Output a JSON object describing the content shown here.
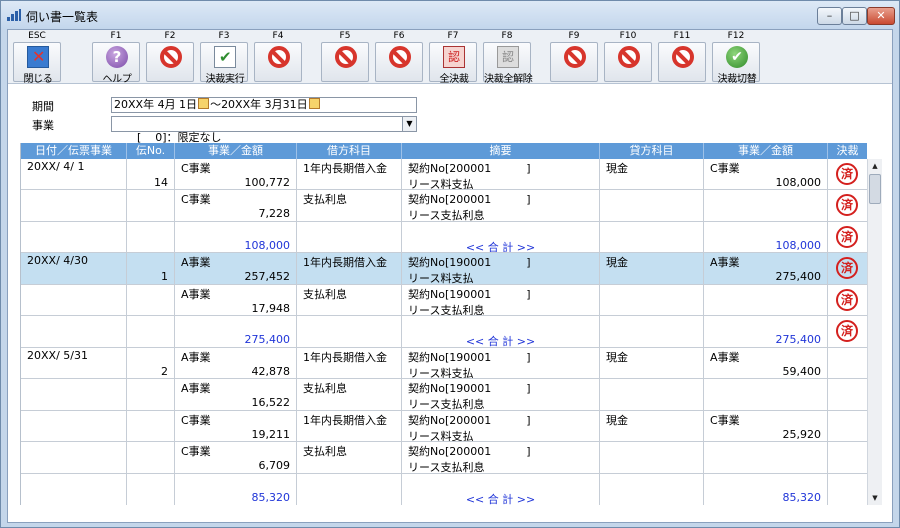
{
  "window": {
    "title": "伺い書一覧表",
    "minimize": "–",
    "maximize": "□",
    "close": "✕"
  },
  "toolbar": [
    {
      "key": "ESC",
      "label": "閉じる",
      "icon": "exit-icon",
      "name": "close-button"
    },
    {
      "key": "F1",
      "label": "ヘルプ",
      "icon": "help-icon",
      "name": "help-button"
    },
    {
      "key": "F2",
      "label": "",
      "icon": "disabled-icon",
      "name": "f2-button"
    },
    {
      "key": "F3",
      "label": "決裁実行",
      "icon": "check-icon",
      "name": "approve-button"
    },
    {
      "key": "F4",
      "label": "",
      "icon": "disabled-icon",
      "name": "f4-button"
    },
    {
      "key": "F5",
      "label": "",
      "icon": "disabled-icon",
      "name": "f5-button"
    },
    {
      "key": "F6",
      "label": "",
      "icon": "disabled-icon",
      "name": "f6-button"
    },
    {
      "key": "F7",
      "label": "全決裁",
      "icon": "stamp-icon",
      "name": "approve-all-button"
    },
    {
      "key": "F8",
      "label": "決裁全解除",
      "icon": "stamp-gray-icon",
      "name": "unapprove-all-button"
    },
    {
      "key": "F9",
      "label": "",
      "icon": "disabled-icon",
      "name": "f9-button"
    },
    {
      "key": "F10",
      "label": "",
      "icon": "disabled-icon",
      "name": "f10-button"
    },
    {
      "key": "F11",
      "label": "",
      "icon": "disabled-icon",
      "name": "f11-button"
    },
    {
      "key": "F12",
      "label": "決裁切替",
      "icon": "ok-icon",
      "name": "toggle-approval-button"
    }
  ],
  "filters": {
    "period_label": "期間",
    "period_start": "20XX年 4月 1日",
    "period_sep": "～",
    "period_end": "20XX年 3月31日",
    "business_label": "事業",
    "business_value": "[    0]：限定なし"
  },
  "columns": [
    "日付／伝票事業",
    "伝No.",
    "事業／金額",
    "借方科目",
    "摘要",
    "貸方科目",
    "事業／金額",
    "決裁"
  ],
  "rows": [
    {
      "date": "20XX/ 4/ 1",
      "no": "14",
      "dr_biz": "C事業",
      "dr_amt": "100,772",
      "dr_acct": "1年内長期借入金",
      "memo1": "契約No[200001          ]",
      "memo2": "リース料支払",
      "cr_acct": "現金",
      "cr_biz": "C事業",
      "cr_amt": "108,000",
      "stamp": "済",
      "selected": false,
      "total": false
    },
    {
      "date": "",
      "no": "",
      "dr_biz": "C事業",
      "dr_amt": "7,228",
      "dr_acct": "支払利息",
      "memo1": "契約No[200001          ]",
      "memo2": "リース支払利息",
      "cr_acct": "",
      "cr_biz": "",
      "cr_amt": "",
      "stamp": "済",
      "selected": false,
      "total": false
    },
    {
      "date": "",
      "no": "",
      "dr_biz": "",
      "dr_amt": "108,000",
      "dr_acct": "",
      "memo1": "",
      "memo2": "<< 合 計 >>",
      "cr_acct": "",
      "cr_biz": "",
      "cr_amt": "108,000",
      "stamp": "済",
      "selected": false,
      "total": true
    },
    {
      "date": "20XX/ 4/30",
      "no": "1",
      "dr_biz": "A事業",
      "dr_amt": "257,452",
      "dr_acct": "1年内長期借入金",
      "memo1": "契約No[190001          ]",
      "memo2": "リース料支払",
      "cr_acct": "現金",
      "cr_biz": "A事業",
      "cr_amt": "275,400",
      "stamp": "済",
      "selected": true,
      "total": false
    },
    {
      "date": "",
      "no": "",
      "dr_biz": "A事業",
      "dr_amt": "17,948",
      "dr_acct": "支払利息",
      "memo1": "契約No[190001          ]",
      "memo2": "リース支払利息",
      "cr_acct": "",
      "cr_biz": "",
      "cr_amt": "",
      "stamp": "済",
      "selected": false,
      "total": false
    },
    {
      "date": "",
      "no": "",
      "dr_biz": "",
      "dr_amt": "275,400",
      "dr_acct": "",
      "memo1": "",
      "memo2": "<< 合 計 >>",
      "cr_acct": "",
      "cr_biz": "",
      "cr_amt": "275,400",
      "stamp": "済",
      "selected": false,
      "total": true
    },
    {
      "date": "20XX/ 5/31",
      "no": "2",
      "dr_biz": "A事業",
      "dr_amt": "42,878",
      "dr_acct": "1年内長期借入金",
      "memo1": "契約No[190001          ]",
      "memo2": "リース料支払",
      "cr_acct": "現金",
      "cr_biz": "A事業",
      "cr_amt": "59,400",
      "stamp": "",
      "selected": false,
      "total": false
    },
    {
      "date": "",
      "no": "",
      "dr_biz": "A事業",
      "dr_amt": "16,522",
      "dr_acct": "支払利息",
      "memo1": "契約No[190001          ]",
      "memo2": "リース支払利息",
      "cr_acct": "",
      "cr_biz": "",
      "cr_amt": "",
      "stamp": "",
      "selected": false,
      "total": false
    },
    {
      "date": "",
      "no": "",
      "dr_biz": "C事業",
      "dr_amt": "19,211",
      "dr_acct": "1年内長期借入金",
      "memo1": "契約No[200001          ]",
      "memo2": "リース料支払",
      "cr_acct": "現金",
      "cr_biz": "C事業",
      "cr_amt": "25,920",
      "stamp": "",
      "selected": false,
      "total": false
    },
    {
      "date": "",
      "no": "",
      "dr_biz": "C事業",
      "dr_amt": "6,709",
      "dr_acct": "支払利息",
      "memo1": "契約No[200001          ]",
      "memo2": "リース支払利息",
      "cr_acct": "",
      "cr_biz": "",
      "cr_amt": "",
      "stamp": "",
      "selected": false,
      "total": false
    },
    {
      "date": "",
      "no": "",
      "dr_biz": "",
      "dr_amt": "85,320",
      "dr_acct": "",
      "memo1": "",
      "memo2": "<< 合 計 >>",
      "cr_acct": "",
      "cr_biz": "",
      "cr_amt": "85,320",
      "stamp": "",
      "selected": false,
      "total": true
    }
  ],
  "scrollbar": {
    "up": "▲",
    "down": "▼"
  },
  "colors": {
    "header": "#5e9ad8",
    "selected_row": "#c4dff1",
    "total_text": "#2035d8",
    "stamp": "#d4201e"
  }
}
